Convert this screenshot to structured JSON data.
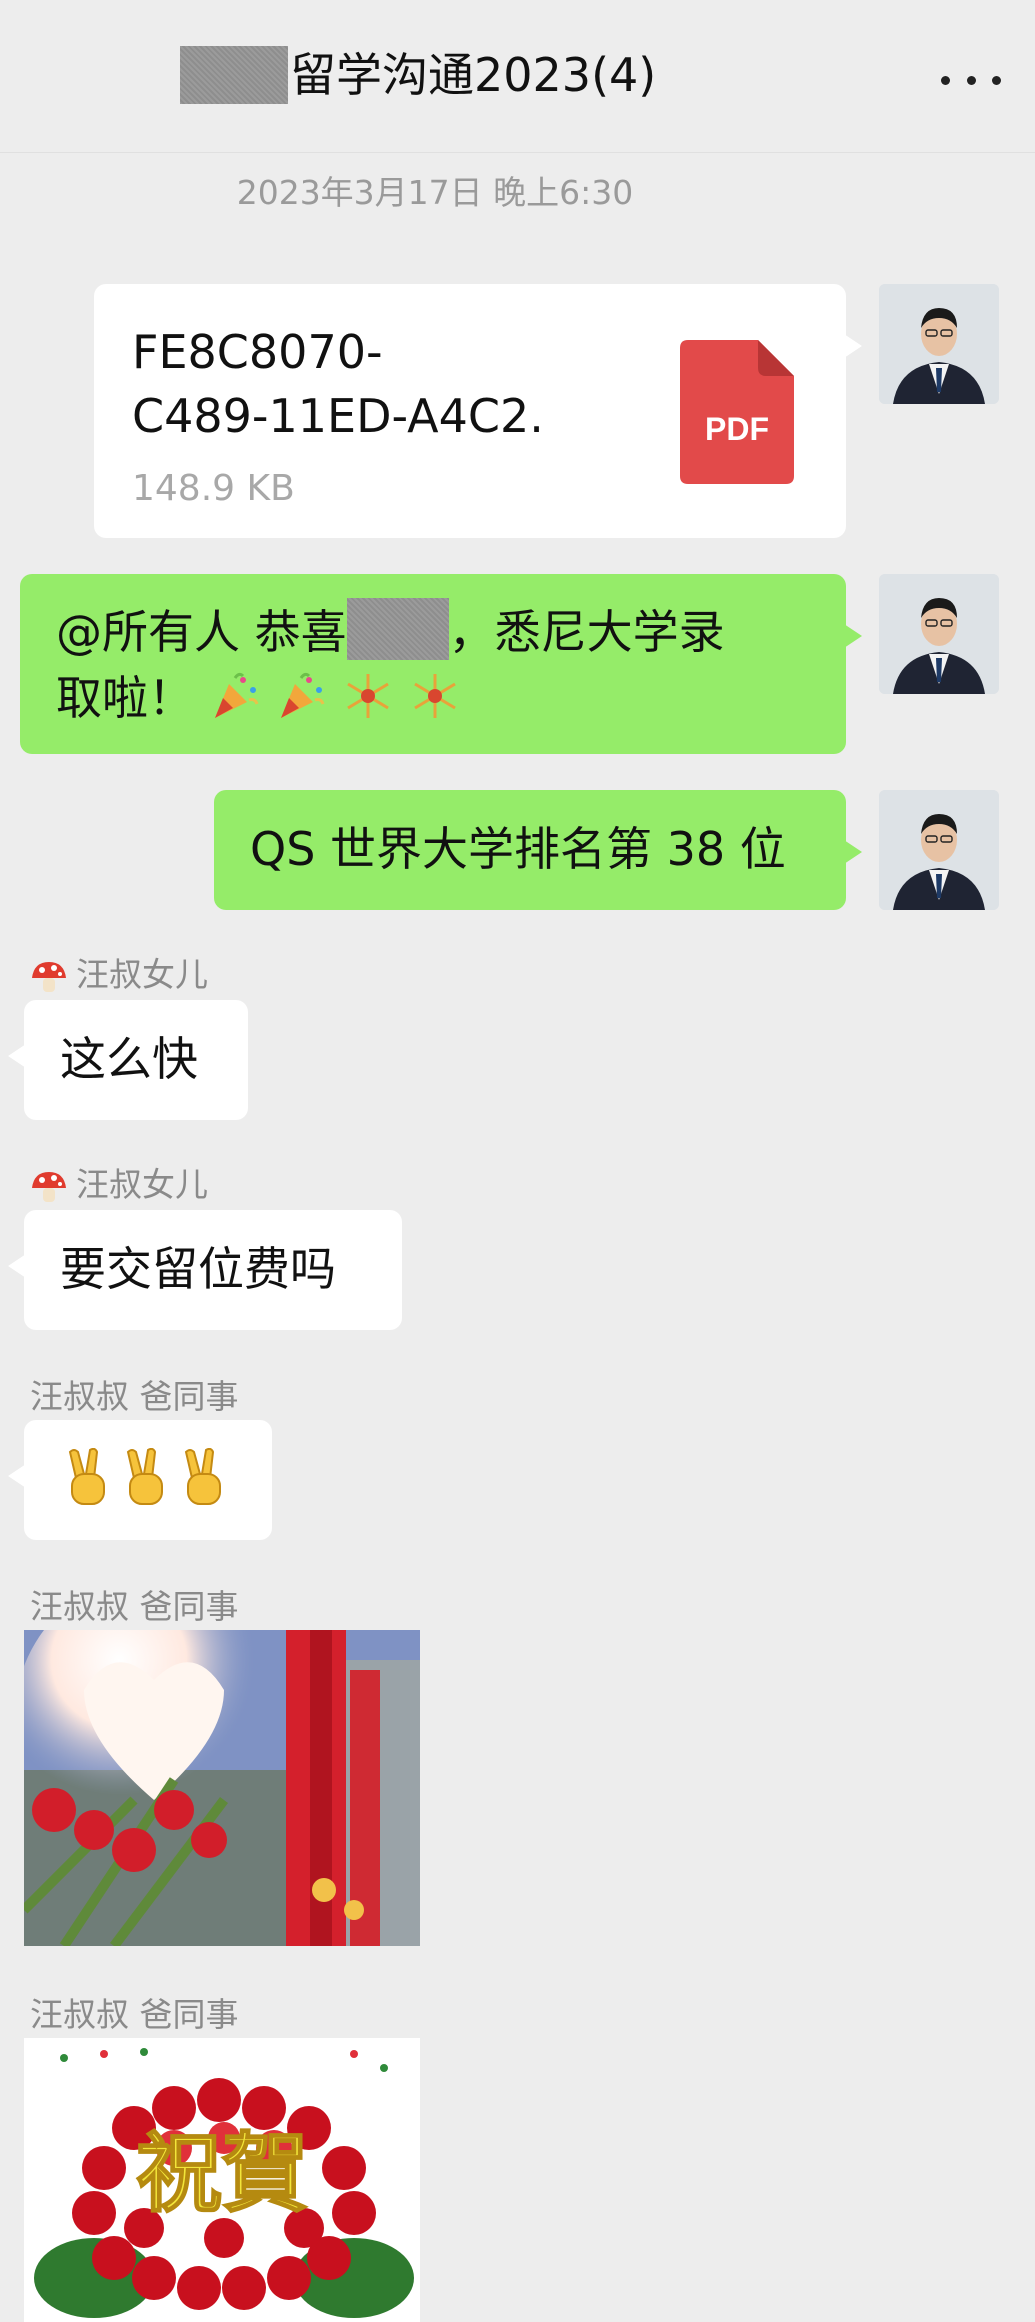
{
  "header": {
    "title": "留学沟通2023(4)",
    "more_icon": "more-horizontal-icon"
  },
  "timestamp": "2023年3月17日 晚上6:30",
  "messages": {
    "file": {
      "name": "FE8C8070-\nC489-11ED-A4C2.",
      "size": "148.9 KB",
      "badge": "PDF"
    },
    "announce": {
      "prefix": "@所有人  恭喜",
      "suffix": "，悉尼大学录",
      "line2": "取啦！"
    },
    "ranking": "QS 世界大学排名第 38 位",
    "m1": {
      "sender": "汪叔女儿",
      "text": "这么快"
    },
    "m2": {
      "sender": "汪叔女儿",
      "text": "要交留位费吗"
    },
    "m3": {
      "sender": "汪叔叔 爸同事"
    },
    "m4": {
      "sender": "汪叔叔 爸同事"
    },
    "m5": {
      "sender": "汪叔叔 爸同事",
      "card_text": "祝賀"
    }
  },
  "colors": {
    "bg": "#ededed",
    "green_bubble": "#95ec69",
    "pdf_red": "#e24a4a"
  }
}
